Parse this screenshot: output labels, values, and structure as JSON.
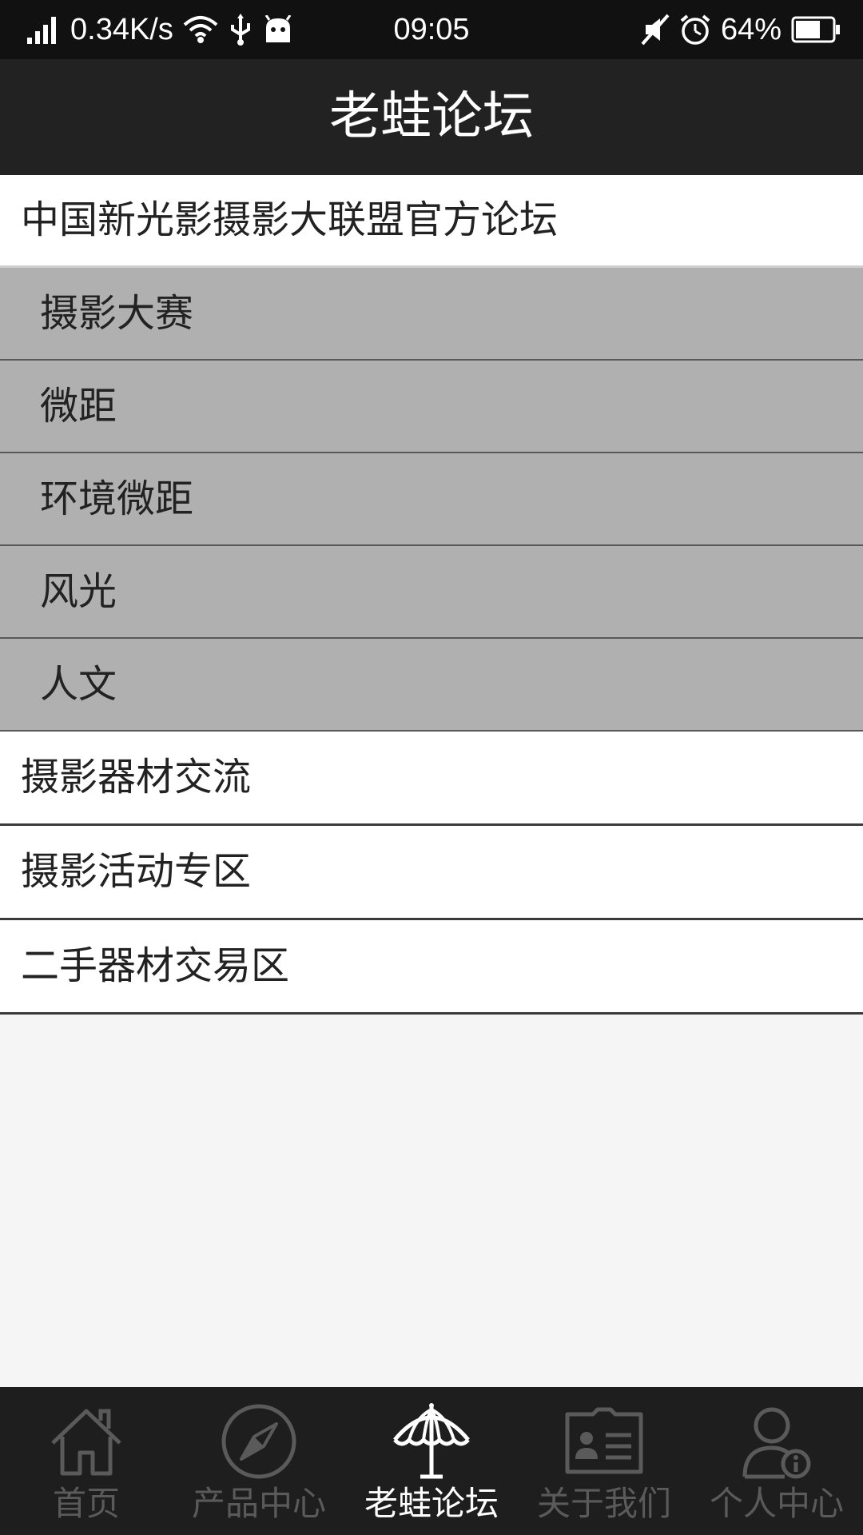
{
  "status_bar": {
    "net_speed": "0.34K/s",
    "time": "09:05",
    "battery": "64%"
  },
  "header": {
    "title": "老蛙论坛"
  },
  "forum": {
    "category": "中国新光影摄影大联盟官方论坛",
    "subforums": [
      {
        "label": "摄影大赛"
      },
      {
        "label": "微距"
      },
      {
        "label": "环境微距"
      },
      {
        "label": "风光"
      },
      {
        "label": "人文"
      }
    ],
    "forums": [
      {
        "label": "摄影器材交流"
      },
      {
        "label": "摄影活动专区"
      },
      {
        "label": "二手器材交易区"
      }
    ]
  },
  "tabs": [
    {
      "label": "首页",
      "icon": "home-icon",
      "active": false
    },
    {
      "label": "产品中心",
      "icon": "compass-icon",
      "active": false
    },
    {
      "label": "老蛙论坛",
      "icon": "umbrella-icon",
      "active": true
    },
    {
      "label": "关于我们",
      "icon": "contact-card-icon",
      "active": false
    },
    {
      "label": "个人中心",
      "icon": "user-info-icon",
      "active": false
    }
  ],
  "colors": {
    "header_bg": "#222222",
    "tab_bar_bg": "#1e1e1e",
    "subforum_bg": "#b0b0b0",
    "tab_inactive": "#5a5a5a",
    "tab_active": "#ffffff"
  }
}
